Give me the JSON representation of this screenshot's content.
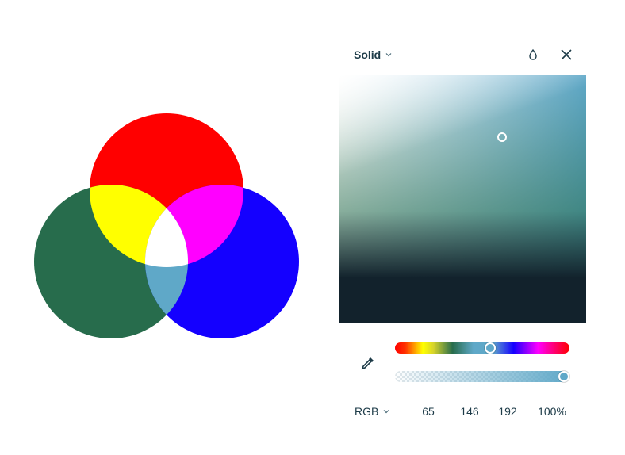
{
  "picker": {
    "mode": "Solid",
    "format": "RGB",
    "rgb": {
      "r": "65",
      "g": "146",
      "b": "192"
    },
    "opacity": "100%",
    "current_color": "#5fa8c8",
    "saturation": 0.66,
    "brightness": 0.75,
    "hue_position": 0.55,
    "alpha_position": 1.0
  },
  "icons": {
    "mode_chevron": "chevron-down-icon",
    "format_chevron": "chevron-down-icon",
    "fill": "droplet-icon",
    "close": "close-icon",
    "eyedropper": "eyedropper-icon"
  },
  "colors": {
    "venn_red": "#ff0000",
    "venn_green": "#276c4c",
    "venn_blue": "#1400ff",
    "venn_yellow": "#ffff00",
    "venn_magenta": "#ff00ff",
    "venn_cyan": "#5fa8c8",
    "venn_white": "#ffffff",
    "text": "#1d3b48"
  }
}
